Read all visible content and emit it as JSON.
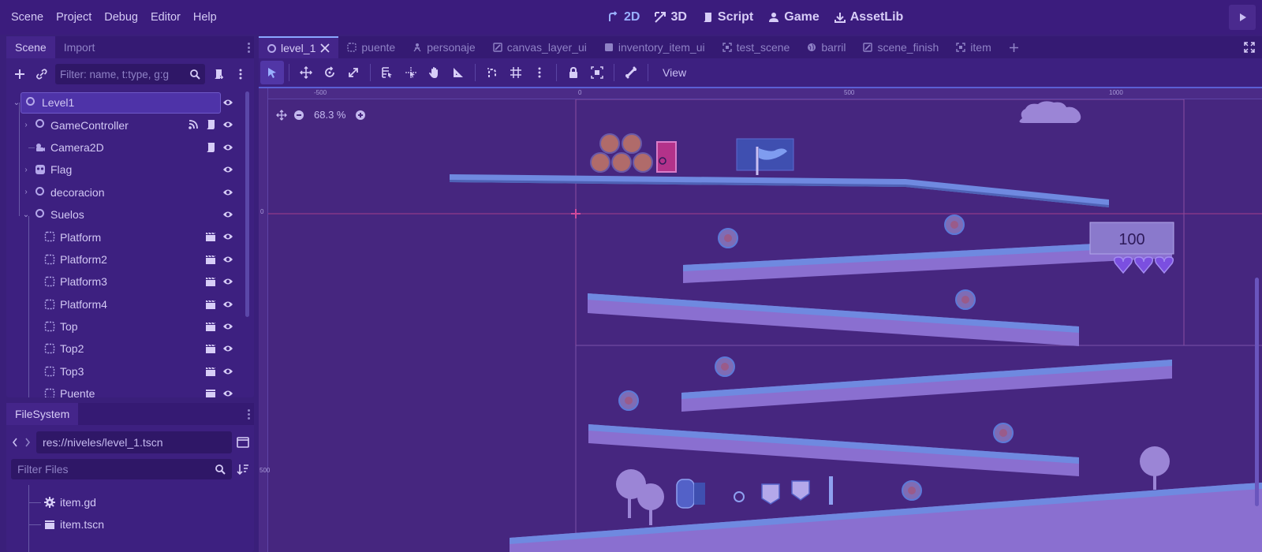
{
  "menu": [
    "Scene",
    "Project",
    "Debug",
    "Editor",
    "Help"
  ],
  "modes": [
    {
      "label": "2D",
      "icon": "2d-icon",
      "active": true
    },
    {
      "label": "3D",
      "icon": "3d-icon",
      "active": false
    },
    {
      "label": "Script",
      "icon": "script-icon",
      "active": false
    },
    {
      "label": "Game",
      "icon": "game-icon",
      "active": false
    },
    {
      "label": "AssetLib",
      "icon": "assetlib-icon",
      "active": false
    }
  ],
  "scene_dock": {
    "tabs": [
      "Scene",
      "Import"
    ],
    "filter_placeholder": "Filter: name, t:type, g:g",
    "nodes": [
      {
        "label": "Level1",
        "depth": 0,
        "expanded": true,
        "icon": "node2d-icon",
        "selected": true,
        "extras": []
      },
      {
        "label": "GameController",
        "depth": 1,
        "expandable": true,
        "icon": "node2d-icon",
        "extras": [
          "signal-icon",
          "script-icon"
        ]
      },
      {
        "label": "Camera2D",
        "depth": 1,
        "icon": "camera-icon",
        "extras": [
          "script-icon"
        ]
      },
      {
        "label": "Flag",
        "depth": 1,
        "expandable": true,
        "icon": "skull-icon",
        "extras": []
      },
      {
        "label": "decoracion",
        "depth": 1,
        "expandable": true,
        "icon": "node2d-icon",
        "extras": []
      },
      {
        "label": "Suelos",
        "depth": 1,
        "expanded": true,
        "icon": "node2d-icon",
        "extras": []
      },
      {
        "label": "Platform",
        "depth": 2,
        "icon": "instance-icon",
        "extras": [
          "clapper-icon"
        ]
      },
      {
        "label": "Platform2",
        "depth": 2,
        "icon": "instance-icon",
        "extras": [
          "clapper-icon"
        ]
      },
      {
        "label": "Platform3",
        "depth": 2,
        "icon": "instance-icon",
        "extras": [
          "clapper-icon"
        ]
      },
      {
        "label": "Platform4",
        "depth": 2,
        "icon": "instance-icon",
        "extras": [
          "clapper-icon"
        ]
      },
      {
        "label": "Top",
        "depth": 2,
        "icon": "instance-icon",
        "extras": [
          "clapper-icon"
        ]
      },
      {
        "label": "Top2",
        "depth": 2,
        "icon": "instance-icon",
        "extras": [
          "clapper-icon"
        ]
      },
      {
        "label": "Top3",
        "depth": 2,
        "icon": "instance-icon",
        "extras": [
          "clapper-icon"
        ]
      },
      {
        "label": "Puente",
        "depth": 2,
        "icon": "instance-icon",
        "extras": [
          "clapper-icon"
        ]
      }
    ]
  },
  "filesystem": {
    "tab": "FileSystem",
    "path": "res://niveles/level_1.tscn",
    "filter_placeholder": "Filter Files",
    "items": [
      {
        "label": "item.gd",
        "icon": "gear-icon"
      },
      {
        "label": "item.tscn",
        "icon": "clapper-icon"
      }
    ]
  },
  "editor_tabs": [
    {
      "label": "level_1",
      "icon": "node2d-icon",
      "active": true,
      "closable": true
    },
    {
      "label": "puente",
      "icon": "instance-icon"
    },
    {
      "label": "personaje",
      "icon": "character-icon"
    },
    {
      "label": "canvas_layer_ui",
      "icon": "canvas-icon"
    },
    {
      "label": "inventory_item_ui",
      "icon": "control-icon"
    },
    {
      "label": "test_scene",
      "icon": "scene-icon"
    },
    {
      "label": "barril",
      "icon": "globe-icon"
    },
    {
      "label": "scene_finish",
      "icon": "canvas-icon"
    },
    {
      "label": "item",
      "icon": "scene-icon"
    }
  ],
  "toolbar": {
    "view_label": "View"
  },
  "viewport": {
    "zoom": "68.3 %",
    "ruler_top": [
      "-500",
      "0",
      "500",
      "1000"
    ],
    "ruler_left": [
      "0",
      "500"
    ],
    "hud_score": "100",
    "hearts": 3
  },
  "colors": {
    "accent": "#8aa6ff",
    "background": "#3a1f7a",
    "panel": "#3d2080",
    "viewport": "#46267f"
  }
}
